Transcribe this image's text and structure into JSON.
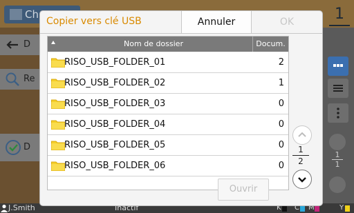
{
  "background": {
    "title_fragment": "Ch",
    "page_number": "1",
    "left_items": [
      {
        "label": "D"
      },
      {
        "label": "Re"
      },
      {
        "label": "D"
      }
    ],
    "right_fraction": {
      "numerator": "1",
      "denominator": "1"
    },
    "status": {
      "user": "J.Smith",
      "state": "Inactif",
      "ink_labels": [
        "K",
        "C",
        "M",
        "Y"
      ]
    }
  },
  "dialog": {
    "title": "Copier vers clé USB",
    "cancel_label": "Annuler",
    "ok_label": "OK",
    "open_label": "Ouvrir",
    "table": {
      "col_name": "Nom de dossier",
      "col_count": "Docum.",
      "rows": [
        {
          "name": "RISO_USB_FOLDER_01",
          "count": "2"
        },
        {
          "name": "RISO_USB_FOLDER_02",
          "count": "1"
        },
        {
          "name": "RISO_USB_FOLDER_03",
          "count": "0"
        },
        {
          "name": "RISO_USB_FOLDER_04",
          "count": "0"
        },
        {
          "name": "RISO_USB_FOLDER_05",
          "count": "0"
        },
        {
          "name": "RISO_USB_FOLDER_06",
          "count": "0"
        }
      ]
    },
    "pager": {
      "current": "1",
      "total": "2"
    }
  },
  "colors": {
    "title_orange": "#d98a00",
    "folder_yellow": "#f5cf2a",
    "ink_black": "#111111",
    "ink_cyan": "#2aa7d9",
    "ink_magenta": "#c2267a",
    "ink_yellow": "#f1d21a"
  }
}
